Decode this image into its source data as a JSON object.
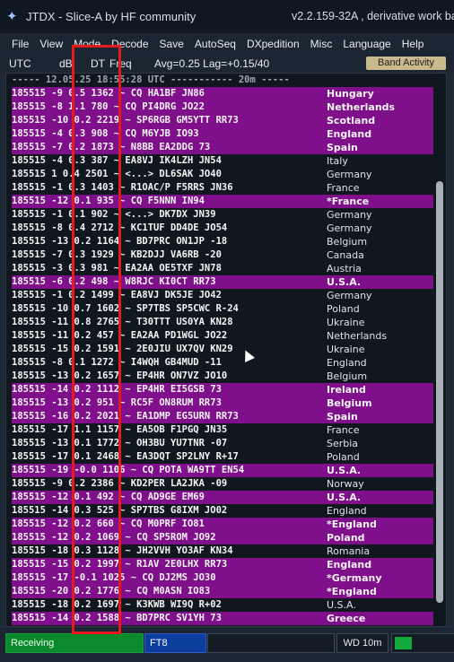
{
  "window": {
    "title": "JTDX - Slice-A  by HF community",
    "title_right": "v2.2.159-32A , derivative work bas",
    "icon": "app-star-icon"
  },
  "menu": [
    "File",
    "View",
    "Mode",
    "Decode",
    "Save",
    "AutoSeq",
    "DXpedition",
    "Misc",
    "Language",
    "Help"
  ],
  "header": {
    "utc": "UTC",
    "db": "dB",
    "dt": "DT",
    "freq": "Freq",
    "stats": "Avg=0.25 Lag=+0.15/40",
    "band_button": "Band Activity"
  },
  "separator": "----- 12.05.25 18:55:28 UTC ----------- 20m -----",
  "rows": [
    {
      "t": "185515",
      "db": "-9",
      "dt": "0.5",
      "f": "1362",
      "m": "~ CQ HA1BF JN86",
      "c": "Hungary",
      "cq": true
    },
    {
      "t": "185515",
      "db": "-8",
      "dt": "1.1",
      "f": "780",
      "m": "~ CQ PI4DRG JO22",
      "c": "Netherlands",
      "cq": true
    },
    {
      "t": "185515",
      "db": "-10",
      "dt": "0.2",
      "f": "2219",
      "m": "~ SP6RGB GM5YTT RR73",
      "c": "Scotland",
      "cq": true
    },
    {
      "t": "185515",
      "db": "-4",
      "dt": "0.3",
      "f": "908",
      "m": "~ CQ M6YJB IO93",
      "c": "England",
      "cq": true
    },
    {
      "t": "185515",
      "db": "-7",
      "dt": "0.2",
      "f": "1873",
      "m": "~ N8BB EA2DDG 73",
      "c": "Spain",
      "cq": true
    },
    {
      "t": "185515",
      "db": "-4",
      "dt": "0.3",
      "f": "387",
      "m": "~ EA8VJ IK4LZH JN54",
      "c": "Italy",
      "cq": false
    },
    {
      "t": "185515",
      "db": "1",
      "dt": "0.4",
      "f": "2501",
      "m": "~ <...> DL6SAK JO40",
      "c": "Germany",
      "cq": false
    },
    {
      "t": "185515",
      "db": "-1",
      "dt": "0.3",
      "f": "1403",
      "m": "~ R1OAC/P F5RRS JN36",
      "c": "France",
      "cq": false
    },
    {
      "t": "185515",
      "db": "-12",
      "dt": "0.1",
      "f": "935",
      "m": "~ CQ F5NNN IN94",
      "c": "*France",
      "cq": true
    },
    {
      "t": "185515",
      "db": "-1",
      "dt": "0.1",
      "f": "902",
      "m": "~ <...> DK7DX JN39",
      "c": "Germany",
      "cq": false
    },
    {
      "t": "185515",
      "db": "-8",
      "dt": "0.4",
      "f": "2712",
      "m": "~ KC1TUF DD4DE JO54",
      "c": "Germany",
      "cq": false
    },
    {
      "t": "185515",
      "db": "-13",
      "dt": "0.2",
      "f": "1164",
      "m": "~ BD7PRC ON1JP -18",
      "c": "Belgium",
      "cq": false
    },
    {
      "t": "185515",
      "db": "-7",
      "dt": "0.3",
      "f": "1929",
      "m": "~ KB2DJJ VA6RB -20",
      "c": "Canada",
      "cq": false
    },
    {
      "t": "185515",
      "db": "-3",
      "dt": "0.3",
      "f": "981",
      "m": "~ EA2AA OE5TXF JN78",
      "c": "Austria",
      "cq": false
    },
    {
      "t": "185515",
      "db": "-6",
      "dt": "0.2",
      "f": "498",
      "m": "~ W8RJC KI0CT RR73",
      "c": "U.S.A.",
      "cq": true
    },
    {
      "t": "185515",
      "db": "-1",
      "dt": "0.2",
      "f": "1499",
      "m": "~ EA8VJ DK5JE JO42",
      "c": "Germany",
      "cq": false
    },
    {
      "t": "185515",
      "db": "-10",
      "dt": "0.7",
      "f": "1602",
      "m": "~ SP7TBS SP5CWC R-24",
      "c": "Poland",
      "cq": false
    },
    {
      "t": "185515",
      "db": "-11",
      "dt": "0.8",
      "f": "2765",
      "m": "~ T30TTT US0YA KN28",
      "c": "Ukraine",
      "cq": false
    },
    {
      "t": "185515",
      "db": "-11",
      "dt": "0.2",
      "f": "457",
      "m": "~ EA2AA PD1WGL JO22",
      "c": "Netherlands",
      "cq": false
    },
    {
      "t": "185515",
      "db": "-15",
      "dt": "0.2",
      "f": "1591",
      "m": "~ 2E0JIU UX7QV KN29",
      "c": "Ukraine",
      "cq": false
    },
    {
      "t": "185515",
      "db": "-8",
      "dt": "0.1",
      "f": "1272",
      "m": "~ I4WQH GB4MUD -11",
      "c": "England",
      "cq": false
    },
    {
      "t": "185515",
      "db": "-13",
      "dt": "0.2",
      "f": "1657",
      "m": "~ EP4HR ON7VZ JO10",
      "c": "Belgium",
      "cq": false
    },
    {
      "t": "185515",
      "db": "-14",
      "dt": "0.2",
      "f": "1112",
      "m": "~ EP4HR EI5GSB 73",
      "c": "Ireland",
      "cq": true
    },
    {
      "t": "185515",
      "db": "-13",
      "dt": "0.2",
      "f": "951",
      "m": "~ RC5F ON8RUM RR73",
      "c": "Belgium",
      "cq": true
    },
    {
      "t": "185515",
      "db": "-16",
      "dt": "0.2",
      "f": "2021",
      "m": "~ EA1DMP EG5URN RR73",
      "c": "Spain",
      "cq": true
    },
    {
      "t": "185515",
      "db": "-17",
      "dt": "1.1",
      "f": "1157",
      "m": "~ EA5OB F1PGQ JN35",
      "c": "France",
      "cq": false
    },
    {
      "t": "185515",
      "db": "-13",
      "dt": "0.1",
      "f": "1772",
      "m": "~ OH3BU YU7TNR -07",
      "c": "Serbia",
      "cq": false
    },
    {
      "t": "185515",
      "db": "-17",
      "dt": "0.1",
      "f": "2468",
      "m": "~ EA3DQT SP2LNY R+17",
      "c": "Poland",
      "cq": false
    },
    {
      "t": "185515",
      "db": "-19",
      "dt": "-0.0",
      "f": "1106",
      "m": "~ CQ POTA WA9TT EN54",
      "c": "U.S.A.",
      "cq": true
    },
    {
      "t": "185515",
      "db": "-9",
      "dt": "0.2",
      "f": "2386",
      "m": "~ KD2PER LA2JKA -09",
      "c": "Norway",
      "cq": false
    },
    {
      "t": "185515",
      "db": "-12",
      "dt": "0.1",
      "f": "492",
      "m": "~ CQ AD9GE EM69",
      "c": "U.S.A.",
      "cq": true
    },
    {
      "t": "185515",
      "db": "-14",
      "dt": "0.3",
      "f": "525",
      "m": "~ SP7TBS G8IXM JO02",
      "c": "England",
      "cq": false
    },
    {
      "t": "185515",
      "db": "-12",
      "dt": "0.2",
      "f": "660",
      "m": "~ CQ M0PRF IO81",
      "c": "*England",
      "cq": true
    },
    {
      "t": "185515",
      "db": "-12",
      "dt": "0.2",
      "f": "1069",
      "m": "~ CQ SP5ROM JO92",
      "c": "Poland",
      "cq": true
    },
    {
      "t": "185515",
      "db": "-18",
      "dt": "0.3",
      "f": "1128",
      "m": "~ JH2VVH YO3AF KN34",
      "c": "Romania",
      "cq": false
    },
    {
      "t": "185515",
      "db": "-15",
      "dt": "0.2",
      "f": "1997",
      "m": "~ R1AV 2E0LHX RR73",
      "c": "England",
      "cq": true
    },
    {
      "t": "185515",
      "db": "-17",
      "dt": "-0.1",
      "f": "1025",
      "m": "~ CQ DJ2MS JO30",
      "c": "*Germany",
      "cq": true
    },
    {
      "t": "185515",
      "db": "-20",
      "dt": "0.2",
      "f": "1776",
      "m": "~ CQ M0ASN IO83",
      "c": "*England",
      "cq": true
    },
    {
      "t": "185515",
      "db": "-18",
      "dt": "0.2",
      "f": "1697",
      "m": "~ K3KWB WI9Q R+02",
      "c": "U.S.A.",
      "cq": false
    },
    {
      "t": "185515",
      "db": "-14",
      "dt": "0.2",
      "f": "1588",
      "m": "~ BD7PRC SV1YH 73",
      "c": "Greece",
      "cq": true
    }
  ],
  "status": {
    "receiving": "Receiving",
    "mode": "FT8",
    "wd": "WD 10m",
    "progress": 0.3
  },
  "colors": {
    "cq_row": "#7f0f8a",
    "highlight": "#e41a1c",
    "receiving": "#0b8a2d",
    "mode": "#0b3e9e"
  }
}
